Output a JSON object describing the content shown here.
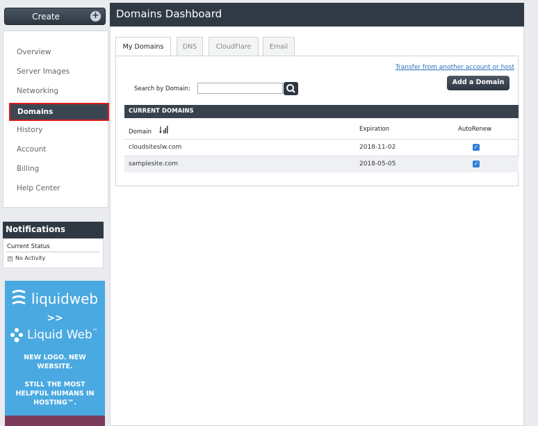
{
  "create_button": {
    "label": "Create",
    "plus": "+"
  },
  "sidebar": {
    "items": [
      {
        "label": "Overview"
      },
      {
        "label": "Server Images"
      },
      {
        "label": "Networking"
      },
      {
        "label": "Domains",
        "active": true
      },
      {
        "label": "History"
      },
      {
        "label": "Account"
      },
      {
        "label": "Billing"
      },
      {
        "label": "Help Center"
      }
    ]
  },
  "notifications": {
    "title": "Notifications",
    "status_label": "Current Status",
    "activity": "No Activity"
  },
  "ad": {
    "logo_old": "liquidweb",
    "arrow": ">>",
    "logo_new": "Liquid Web",
    "trademark": "™",
    "line1": "NEW LOGO. NEW",
    "line2": "WEBSITE.",
    "line3": "STILL THE MOST",
    "line4": "HELPFUL HUMANS IN",
    "line5": "HOSTING™."
  },
  "page": {
    "title": "Domains Dashboard"
  },
  "tabs": [
    {
      "label": "My Domains",
      "active": true
    },
    {
      "label": "DNS"
    },
    {
      "label": "CloudFlare"
    },
    {
      "label": "Email"
    }
  ],
  "domains": {
    "transfer_link": "Transfer from another account or host",
    "search_label": "Search by Domain:",
    "search_value": "",
    "add_button": "Add a Domain",
    "section_title": "CURRENT DOMAINS",
    "columns": {
      "domain": "Domain",
      "expiration": "Expiration",
      "autorenew": "AutoRenew"
    },
    "rows": [
      {
        "domain": "cloudsiteslw.com",
        "expiration": "2018-11-02",
        "autorenew": true
      },
      {
        "domain": "samplesite.com",
        "expiration": "2018-05-05",
        "autorenew": true
      }
    ]
  },
  "colors": {
    "header": "#303a45",
    "accent": "#2f7fd8",
    "highlight": "#e11a1a",
    "ad": "#4aa9e0"
  }
}
